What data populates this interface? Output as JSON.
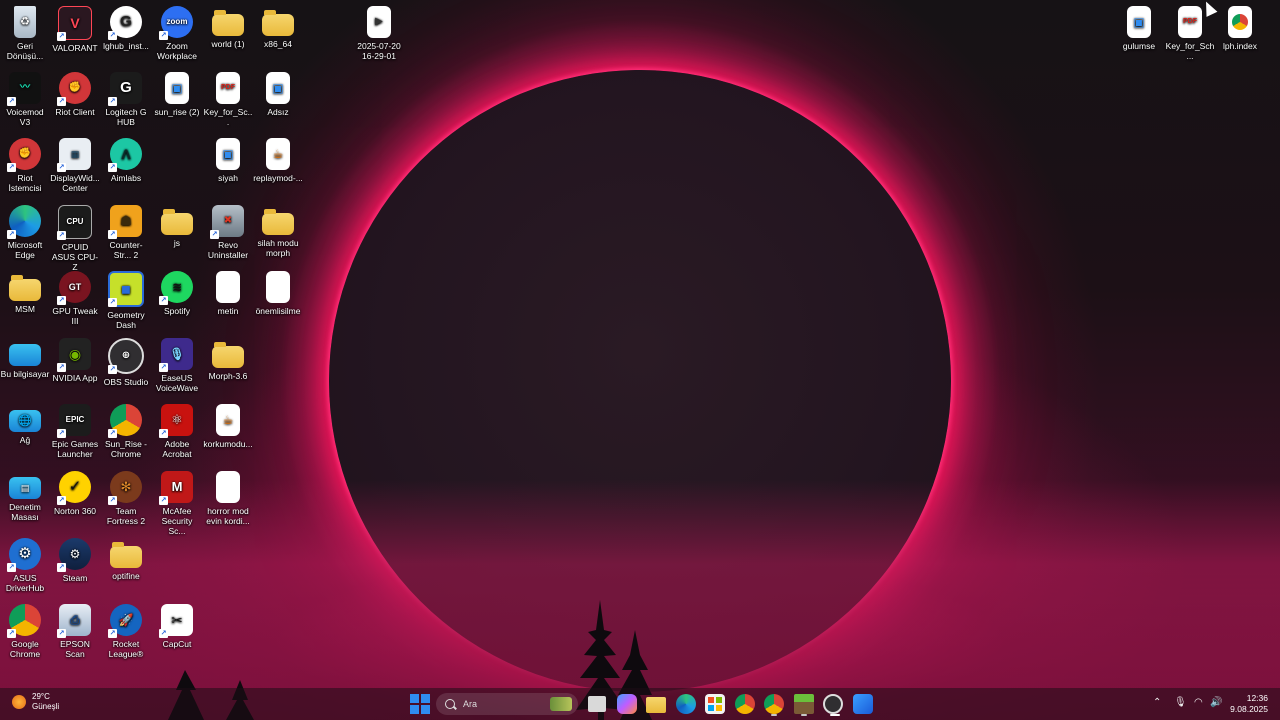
{
  "desktop": {
    "row1": [
      "Geri Dönüşü...",
      "VALORANT",
      "lghub_inst...",
      "Zoom Workplace",
      "world (1)",
      "x86_64"
    ],
    "recording": "2025-07-20 16-29-01",
    "right": [
      "gulumse",
      "Key_for_Sch...",
      "lph.index"
    ],
    "row2": [
      "Voicemod V3",
      "Riot Client",
      "Logitech G HUB",
      "sun_rise (2)",
      "Key_for_Sc...",
      "Adsız"
    ],
    "row3": [
      "Riot İstemcisi",
      "DisplayWid... Center",
      "Aimlabs",
      "siyah",
      "replaymod-..."
    ],
    "row4": [
      "Microsoft Edge",
      "CPUID ASUS CPU-Z",
      "Counter-Str... 2",
      "js",
      "Revo Uninstaller",
      "silah modu morph"
    ],
    "row5": [
      "MSM",
      "GPU Tweak III",
      "Geometry Dash",
      "Spotify",
      "metin",
      "önemlisilme"
    ],
    "row6": [
      "Bu bilgisayar",
      "NVIDIA App",
      "OBS Studio",
      "EaseUS VoiceWave",
      "Morph-3.6"
    ],
    "row7": [
      "Ağ",
      "Epic Games Launcher",
      "Sun_Rise - Chrome",
      "Adobe Acrobat",
      "korkumodu..."
    ],
    "row8": [
      "Denetim Masası",
      "Norton 360",
      "Team Fortress 2",
      "McAfee Security Sc...",
      "horror mod evin kordi..."
    ],
    "row9": [
      "ASUS DriverHub",
      "Steam",
      "optifine"
    ],
    "row10": [
      "Google Chrome",
      "EPSON Scan",
      "Rocket League®",
      "CapCut"
    ],
    "glyph_text": {
      "zoom": "zoom",
      "pdf": "PDF",
      "epic": "EPIC",
      "gt": "GT"
    }
  },
  "taskbar": {
    "weather_temp": "29°C",
    "weather_desc": "Güneşli",
    "search_placeholder": "Ara",
    "time": "12:36",
    "date": "9.08.2025"
  },
  "colors": {
    "accent_ring": "#ff2f78",
    "folder": "#f0c84e",
    "windows_blue": "#2f8cf0"
  }
}
